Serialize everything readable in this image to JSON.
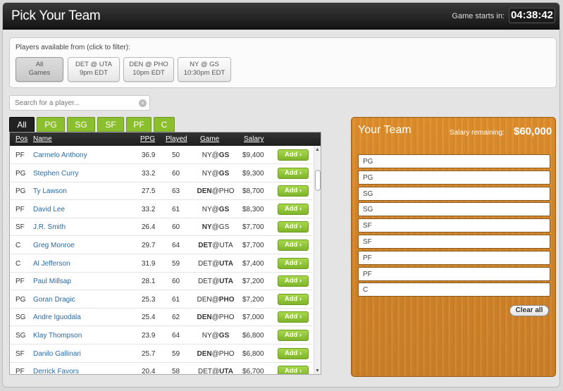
{
  "header": {
    "title": "Pick Your Team",
    "starts_label": "Game starts in:",
    "timer": "04:38:42"
  },
  "filter": {
    "caption": "Players available from (click to filter):",
    "games": [
      {
        "line1": "All",
        "line2": "Games",
        "active": true
      },
      {
        "line1": "DET @ UTA",
        "line2": "9pm EDT",
        "active": false
      },
      {
        "line1": "DEN @ PHO",
        "line2": "10pm EDT",
        "active": false
      },
      {
        "line1": "NY @ GS",
        "line2": "10:30pm EDT",
        "active": false
      }
    ]
  },
  "search": {
    "placeholder": "Search for a player..."
  },
  "tabs": [
    "All",
    "PG",
    "SG",
    "SF",
    "PF",
    "C"
  ],
  "table": {
    "headers": {
      "pos": "Pos",
      "name": "Name",
      "ppg": "PPG",
      "played": "Played",
      "game": "Game",
      "salary": "Salary"
    },
    "add_label": "Add ›",
    "rows": [
      {
        "pos": "PF",
        "name": "Carmelo Anthony",
        "ppg": "36.9",
        "played": "50",
        "away": "NY",
        "home": "GS",
        "bold": "home",
        "salary": "$9,400"
      },
      {
        "pos": "PG",
        "name": "Stephen Curry",
        "ppg": "33.2",
        "played": "60",
        "away": "NY",
        "home": "GS",
        "bold": "home",
        "salary": "$9,300"
      },
      {
        "pos": "PG",
        "name": "Ty Lawson",
        "ppg": "27.5",
        "played": "63",
        "away": "DEN",
        "home": "PHO",
        "bold": "away",
        "salary": "$8,700"
      },
      {
        "pos": "PF",
        "name": "David Lee",
        "ppg": "33.2",
        "played": "61",
        "away": "NY",
        "home": "GS",
        "bold": "home",
        "salary": "$8,300"
      },
      {
        "pos": "SF",
        "name": "J.R. Smith",
        "ppg": "26.4",
        "played": "60",
        "away": "NY",
        "home": "GS",
        "bold": "away",
        "salary": "$7,700"
      },
      {
        "pos": "C",
        "name": "Greg Monroe",
        "ppg": "29.7",
        "played": "64",
        "away": "DET",
        "home": "UTA",
        "bold": "away",
        "salary": "$7,700"
      },
      {
        "pos": "C",
        "name": "Al Jefferson",
        "ppg": "31.9",
        "played": "59",
        "away": "DET",
        "home": "UTA",
        "bold": "home",
        "salary": "$7,400"
      },
      {
        "pos": "PF",
        "name": "Paul Millsap",
        "ppg": "28.1",
        "played": "60",
        "away": "DET",
        "home": "UTA",
        "bold": "home",
        "salary": "$7,200"
      },
      {
        "pos": "PG",
        "name": "Goran Dragic",
        "ppg": "25.3",
        "played": "61",
        "away": "DEN",
        "home": "PHO",
        "bold": "home",
        "salary": "$7,200"
      },
      {
        "pos": "SG",
        "name": "Andre Iguodala",
        "ppg": "25.4",
        "played": "62",
        "away": "DEN",
        "home": "PHO",
        "bold": "away",
        "salary": "$7,000"
      },
      {
        "pos": "SG",
        "name": "Klay Thompson",
        "ppg": "23.9",
        "played": "64",
        "away": "NY",
        "home": "GS",
        "bold": "home",
        "salary": "$6,800"
      },
      {
        "pos": "SF",
        "name": "Danilo Gallinari",
        "ppg": "25.7",
        "played": "59",
        "away": "DEN",
        "home": "PHO",
        "bold": "away",
        "salary": "$6,800"
      },
      {
        "pos": "PF",
        "name": "Derrick Favors",
        "ppg": "20.4",
        "played": "58",
        "away": "DET",
        "home": "UTA",
        "bold": "home",
        "salary": "$6,700"
      }
    ]
  },
  "team": {
    "title": "Your Team",
    "salary_label": "Salary remaining:",
    "salary_value": "$60,000",
    "slots": [
      "PG",
      "PG",
      "SG",
      "SG",
      "SF",
      "SF",
      "PF",
      "PF",
      "C"
    ],
    "clear_label": "Clear all"
  },
  "colors": {
    "accent_green": "#8cbf2d",
    "panel_wood": "#d5862a",
    "link_blue": "#2a6aa5"
  }
}
